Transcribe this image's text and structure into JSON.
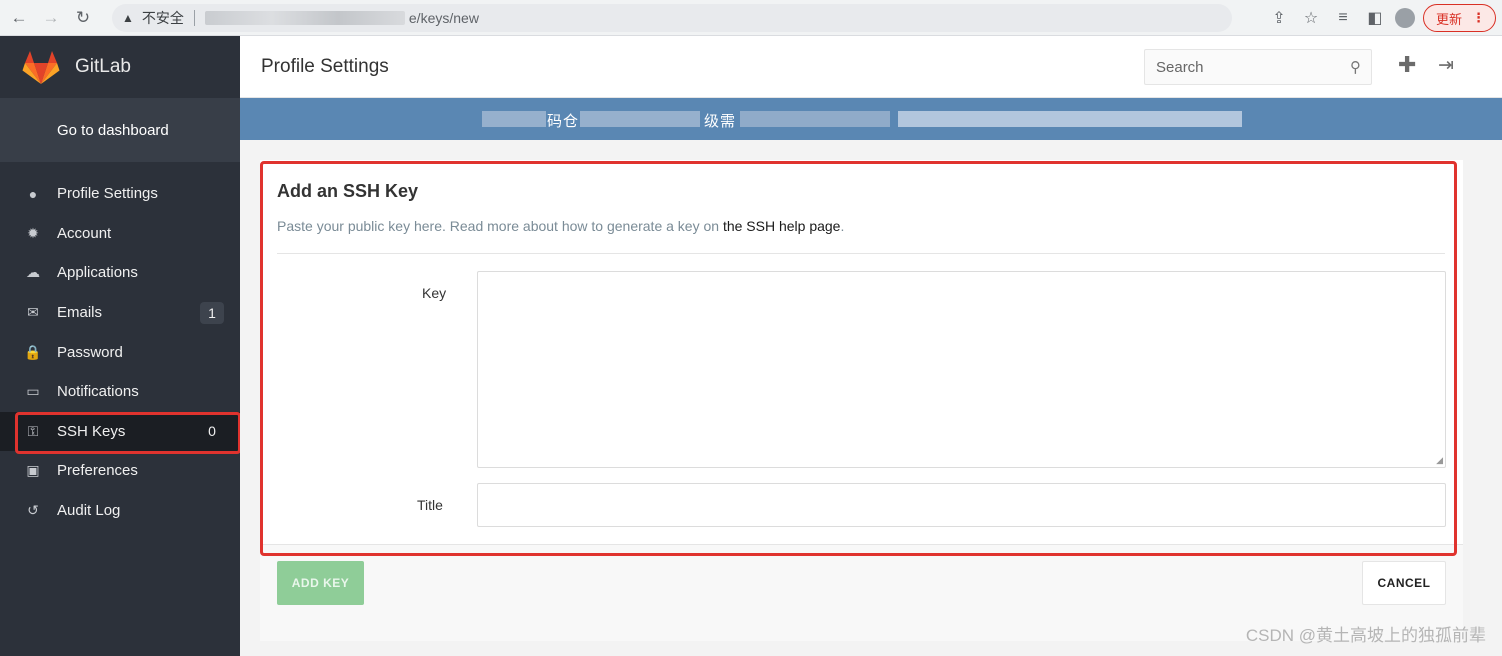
{
  "browser": {
    "security_label": "不安全",
    "url_tail": "e/keys/new",
    "update_label": "更新"
  },
  "sidebar": {
    "brand": "GitLab",
    "dashboard": "Go to dashboard",
    "items": [
      {
        "label": "Profile Settings",
        "icon": "user-icon",
        "glyph": "●"
      },
      {
        "label": "Account",
        "icon": "gear-icon",
        "glyph": "✹"
      },
      {
        "label": "Applications",
        "icon": "cloud-icon",
        "glyph": "☁"
      },
      {
        "label": "Emails",
        "icon": "envelope-icon",
        "glyph": "✉",
        "count": "1"
      },
      {
        "label": "Password",
        "icon": "lock-icon",
        "glyph": "🔒"
      },
      {
        "label": "Notifications",
        "icon": "inbox-icon",
        "glyph": "▭"
      },
      {
        "label": "SSH Keys",
        "icon": "key-icon",
        "glyph": "⚿",
        "count": "0",
        "active": true
      },
      {
        "label": "Preferences",
        "icon": "image-icon",
        "glyph": "▣"
      },
      {
        "label": "Audit Log",
        "icon": "history-icon",
        "glyph": "↺"
      }
    ]
  },
  "header": {
    "title": "Profile Settings",
    "search_placeholder": "Search"
  },
  "banner": {
    "text_1": "码仓",
    "text_2": "级需"
  },
  "form": {
    "title": "Add an SSH Key",
    "description": "Paste your public key here. Read more about how to generate a key on ",
    "help_link": "the SSH help page",
    "description_end": ".",
    "key_label": "Key",
    "key_value": "",
    "title_label": "Title",
    "title_value": "",
    "add_button": "ADD KEY",
    "cancel_button": "CANCEL"
  },
  "watermark": "CSDN @黄土高坡上的独孤前辈",
  "colors": {
    "sidebar_bg": "#2c313a",
    "banner_bg": "#5a87b3",
    "highlight": "#e0332e",
    "add_button": "#8fcd98"
  }
}
